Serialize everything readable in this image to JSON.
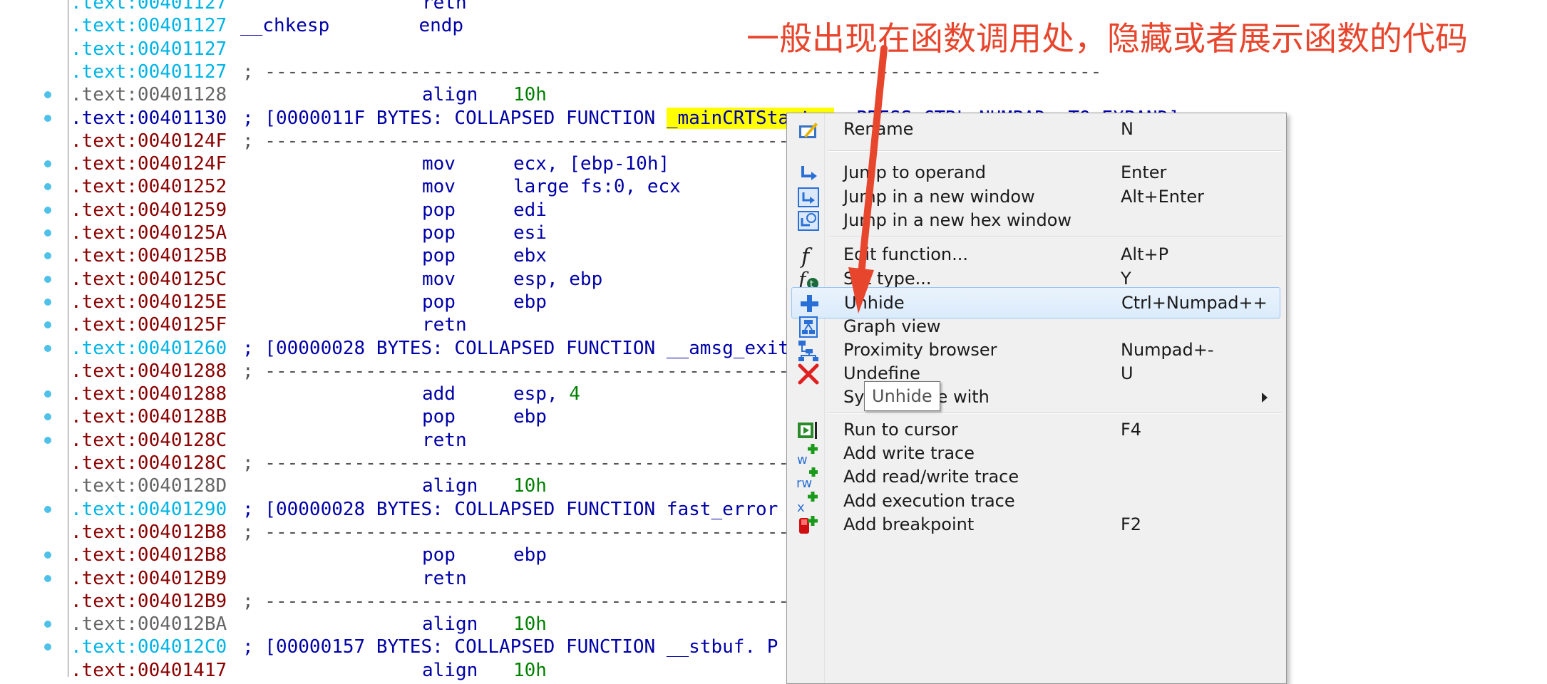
{
  "listing": {
    "lines": [
      {
        "addr": ".text:00401127",
        "seg": "cyan",
        "kind": "code",
        "mnem": "retn",
        "ops": "",
        "dot": false
      },
      {
        "addr": ".text:00401127",
        "seg": "cyan",
        "kind": "proc",
        "text": "__chkesp        endp",
        "dot": false
      },
      {
        "addr": ".text:00401127",
        "seg": "cyan",
        "kind": "blank",
        "dot": false
      },
      {
        "addr": ".text:00401127",
        "seg": "cyan",
        "kind": "sep",
        "text": "; ---------------------------------------------------------------------------",
        "dot": false
      },
      {
        "addr": ".text:00401128",
        "seg": "gray",
        "kind": "code",
        "mnem": "align",
        "ops": "10h",
        "ops_green": true,
        "dot": true
      },
      {
        "addr": ".text:00401130",
        "seg": "blue",
        "kind": "collapsed",
        "text_pre": "; [0000011F BYTES: COLLAPSED FUNCTION ",
        "text_hl": "_mainCRTStartup",
        "text_post": ". PRESS CTRL-NUMPAD+ TO EXPAND]",
        "dot": true
      },
      {
        "addr": ".text:0040124F",
        "seg": "red",
        "kind": "sep",
        "text": "; ---------------------------------------------------------------------------",
        "dot": false
      },
      {
        "addr": ".text:0040124F",
        "seg": "red",
        "kind": "code",
        "mnem": "mov",
        "ops": "ecx, [ebp-10h]",
        "dot": true
      },
      {
        "addr": ".text:00401252",
        "seg": "red",
        "kind": "code",
        "mnem": "mov",
        "ops": "large fs:0, ecx",
        "dot": true
      },
      {
        "addr": ".text:00401259",
        "seg": "red",
        "kind": "code",
        "mnem": "pop",
        "ops": "edi",
        "dot": true
      },
      {
        "addr": ".text:0040125A",
        "seg": "red",
        "kind": "code",
        "mnem": "pop",
        "ops": "esi",
        "dot": true
      },
      {
        "addr": ".text:0040125B",
        "seg": "red",
        "kind": "code",
        "mnem": "pop",
        "ops": "ebx",
        "dot": true
      },
      {
        "addr": ".text:0040125C",
        "seg": "red",
        "kind": "code",
        "mnem": "mov",
        "ops": "esp, ebp",
        "dot": true
      },
      {
        "addr": ".text:0040125E",
        "seg": "red",
        "kind": "code",
        "mnem": "pop",
        "ops": "ebp",
        "dot": true
      },
      {
        "addr": ".text:0040125F",
        "seg": "red",
        "kind": "code",
        "mnem": "retn",
        "ops": "",
        "dot": true
      },
      {
        "addr": ".text:00401260",
        "seg": "cyan",
        "kind": "collapsed",
        "text_pre": "; [00000028 BYTES: COLLAPSED FUNCTION __amsg_exit",
        "text_hl": "",
        "text_post": "",
        "dot": true
      },
      {
        "addr": ".text:00401288",
        "seg": "red",
        "kind": "sep",
        "text": "; ---------------------------------------------------------------------------",
        "dot": false
      },
      {
        "addr": ".text:00401288",
        "seg": "red",
        "kind": "code",
        "mnem": "add",
        "ops": "esp, ",
        "ops_num": "4",
        "dot": true
      },
      {
        "addr": ".text:0040128B",
        "seg": "red",
        "kind": "code",
        "mnem": "pop",
        "ops": "ebp",
        "dot": true
      },
      {
        "addr": ".text:0040128C",
        "seg": "red",
        "kind": "code",
        "mnem": "retn",
        "ops": "",
        "dot": true
      },
      {
        "addr": ".text:0040128C",
        "seg": "red",
        "kind": "sep",
        "text": "; ---------------------------------------------------------------------------",
        "dot": false
      },
      {
        "addr": ".text:0040128D",
        "seg": "gray",
        "kind": "code",
        "mnem": "align",
        "ops": "10h",
        "ops_green": true,
        "dot": false
      },
      {
        "addr": ".text:00401290",
        "seg": "cyan",
        "kind": "collapsed",
        "text_pre": "; [00000028 BYTES: COLLAPSED FUNCTION fast_error",
        "text_hl": "",
        "text_post": "",
        "dot": true
      },
      {
        "addr": ".text:004012B8",
        "seg": "red",
        "kind": "sep",
        "text": "; ---------------------------------------------------------------------------",
        "dot": false
      },
      {
        "addr": ".text:004012B8",
        "seg": "red",
        "kind": "code",
        "mnem": "pop",
        "ops": "ebp",
        "dot": true
      },
      {
        "addr": ".text:004012B9",
        "seg": "red",
        "kind": "code",
        "mnem": "retn",
        "ops": "",
        "dot": true
      },
      {
        "addr": ".text:004012B9",
        "seg": "red",
        "kind": "sep",
        "text": "; ---------------------------------------------------------------------------",
        "dot": false
      },
      {
        "addr": ".text:004012BA",
        "seg": "gray",
        "kind": "code",
        "mnem": "align",
        "ops": "10h",
        "ops_green": true,
        "dot": true
      },
      {
        "addr": ".text:004012C0",
        "seg": "cyan",
        "kind": "collapsed",
        "text_pre": "; [00000157 BYTES: COLLAPSED FUNCTION __stbuf. P",
        "text_hl": "",
        "text_post": "",
        "dot": true
      },
      {
        "addr": ".text:00401417",
        "seg": "red",
        "kind": "code",
        "mnem": "align",
        "ops": "10h",
        "ops_green": true,
        "dot": false
      }
    ]
  },
  "menu": {
    "items": [
      {
        "type": "item",
        "icon": "rename-icon",
        "label": "Rename",
        "shortcut": "N"
      },
      {
        "type": "sep"
      },
      {
        "type": "item",
        "icon": "jump-operand-icon",
        "label": "Jump to operand",
        "shortcut": "Enter"
      },
      {
        "type": "item",
        "icon": "jump-new-window-icon",
        "label": "Jump in a new window",
        "shortcut": "Alt+Enter"
      },
      {
        "type": "item",
        "icon": "jump-hex-window-icon",
        "label": "Jump in a new hex window",
        "shortcut": ""
      },
      {
        "type": "sep"
      },
      {
        "type": "item",
        "icon": "edit-function-icon",
        "label": "Edit function...",
        "shortcut": "Alt+P"
      },
      {
        "type": "item",
        "icon": "set-type-icon",
        "label": "Set type...",
        "shortcut": "Y"
      },
      {
        "type": "item",
        "icon": "unhide-icon",
        "label": "Unhide",
        "shortcut": "Ctrl+Numpad++",
        "selected": true
      },
      {
        "type": "item",
        "icon": "graph-view-icon",
        "label": "Graph view",
        "shortcut": ""
      },
      {
        "type": "item",
        "icon": "proximity-browser-icon",
        "label": "Proximity browser",
        "shortcut": "Numpad+-"
      },
      {
        "type": "item",
        "icon": "undefine-icon",
        "label": "Undefine",
        "shortcut": "U"
      },
      {
        "type": "item",
        "icon": "",
        "label": "Synchronize with",
        "shortcut": "",
        "submenu": true
      },
      {
        "type": "sep"
      },
      {
        "type": "item",
        "icon": "run-to-cursor-icon",
        "label": "Run to cursor",
        "shortcut": "F4"
      },
      {
        "type": "item",
        "icon": "add-write-trace-icon",
        "label": "Add write trace",
        "shortcut": ""
      },
      {
        "type": "item",
        "icon": "add-read-write-trace-icon",
        "label": "Add read/write trace",
        "shortcut": ""
      },
      {
        "type": "item",
        "icon": "add-execution-trace-icon",
        "label": "Add execution trace",
        "shortcut": ""
      },
      {
        "type": "item",
        "icon": "add-breakpoint-icon",
        "label": "Add breakpoint",
        "shortcut": "F2"
      }
    ],
    "tooltip": "Unhide"
  },
  "annotation": {
    "text": "一般出现在函数调用处，隐藏或者展示函数的代码",
    "color": "#e8452d"
  },
  "colors": {
    "seg_cyan": "#00b4e6",
    "seg_red": "#8b0000",
    "seg_gray": "#666666",
    "code_blue": "#0000a8",
    "num_green": "#008000",
    "highlight": "#ffff00"
  }
}
